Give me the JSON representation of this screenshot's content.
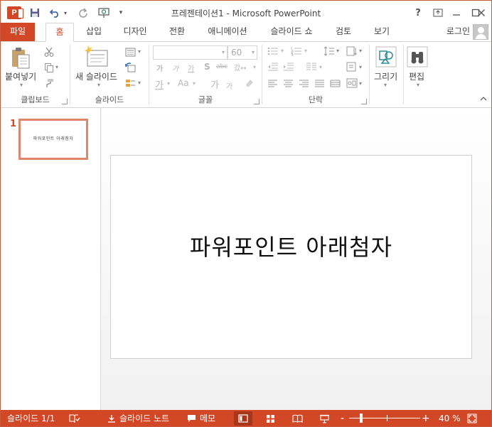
{
  "window": {
    "title": "프레젠테이션1 - Microsoft PowerPoint",
    "app_logo": "P"
  },
  "qat": {
    "customize": "▾"
  },
  "tabs": [
    {
      "label": "파일",
      "id": "file"
    },
    {
      "label": "홈",
      "id": "home"
    },
    {
      "label": "삽입",
      "id": "insert"
    },
    {
      "label": "디자인",
      "id": "design"
    },
    {
      "label": "전환",
      "id": "transitions"
    },
    {
      "label": "애니메이션",
      "id": "animations"
    },
    {
      "label": "슬라이드 쇼",
      "id": "slideshow"
    },
    {
      "label": "검토",
      "id": "review"
    },
    {
      "label": "보기",
      "id": "view"
    }
  ],
  "account": {
    "login": "로그인"
  },
  "ribbon": {
    "clipboard": {
      "label": "클립보드",
      "paste": "붙여넣기"
    },
    "slides": {
      "label": "슬라이드",
      "new_slide": "새 슬라이드"
    },
    "font": {
      "label": "글꼴",
      "font_size": "60",
      "bold": "가",
      "italic": "가",
      "underline": "가",
      "shadow": "S",
      "strike": "abc",
      "spacing": "갔↔",
      "case": "Aa",
      "font_color": "가",
      "grow": "가",
      "shrink": "가"
    },
    "paragraph": {
      "label": "단락"
    },
    "drawing": {
      "label": "그리기"
    },
    "editing": {
      "label": "편집"
    }
  },
  "slide_pane": {
    "number": "1",
    "thumb_text": "파워포인트  아래첨자"
  },
  "slide": {
    "text": "파워포인트  아래첨자"
  },
  "status": {
    "slide_count": "슬라이드 1/1",
    "notes": "슬라이드 노트",
    "comments": "메모",
    "zoom": "40 %"
  },
  "colors": {
    "accent": "#d24726",
    "status_dark": "#a83619"
  }
}
